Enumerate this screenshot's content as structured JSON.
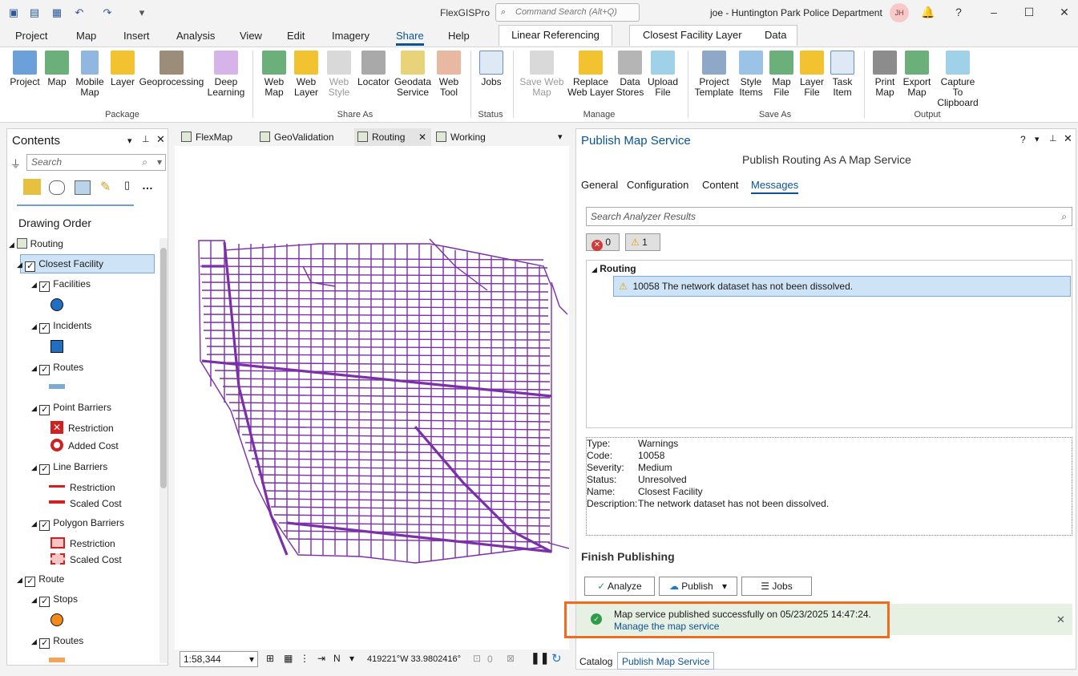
{
  "app": {
    "name": "FlexGISPro",
    "user": "joe - Huntington Park Police Department",
    "avatar_initials": "JH",
    "command_search_placeholder": "Command Search (Alt+Q)"
  },
  "menu": [
    "Project",
    "Map",
    "Insert",
    "Analysis",
    "View",
    "Edit",
    "Imagery",
    "Share",
    "Help"
  ],
  "context_tabs": [
    "Linear Referencing",
    "Closest Facility Layer",
    "Data"
  ],
  "ribbon": {
    "package": {
      "label": "Package",
      "items": [
        "Project",
        "Map",
        "Mobile Map",
        "Layer",
        "Geoprocessing",
        "Deep Learning"
      ]
    },
    "share_as": {
      "label": "Share As",
      "items": [
        "Web Map",
        "Web Layer",
        "Web Style",
        "Locator",
        "Geodata Service",
        "Web Tool"
      ]
    },
    "status": {
      "label": "Status",
      "items": [
        "Jobs"
      ]
    },
    "manage": {
      "label": "Manage",
      "items": [
        "Save Web Map",
        "Replace Web Layer",
        "Data Stores",
        "Upload File"
      ]
    },
    "save_as": {
      "label": "Save As",
      "items": [
        "Project Template",
        "Style Items",
        "Map File",
        "Layer File",
        "Task Item"
      ]
    },
    "output": {
      "label": "Output",
      "items": [
        "Print Map",
        "Export Map",
        "Capture To Clipboard"
      ]
    }
  },
  "contents": {
    "title": "Contents",
    "search_placeholder": "Search",
    "drawing_order": "Drawing Order",
    "map_name": "Routing",
    "layers": [
      "Closest Facility",
      "Facilities",
      "Incidents",
      "Routes",
      "Point Barriers",
      "Restriction",
      "Added Cost",
      "Line Barriers",
      "Restriction",
      "Scaled Cost",
      "Polygon Barriers",
      "Restriction",
      "Scaled Cost",
      "Route",
      "Stops",
      "Routes"
    ]
  },
  "map_tabs": [
    "FlexMap",
    "GeoValidation",
    "Routing",
    "Working"
  ],
  "statusbar": {
    "scale": "1:58,344",
    "coords": "419221°W 33.9802416°",
    "selected": "0"
  },
  "publish": {
    "title": "Publish Map Service",
    "subtitle": "Publish Routing As A Map Service",
    "tabs": [
      "General",
      "Configuration",
      "Content",
      "Messages"
    ],
    "search_placeholder": "Search Analyzer Results",
    "error_count": "0",
    "warning_count": "1",
    "group": "Routing",
    "message": "10058 The network dataset has not been dissolved.",
    "details": {
      "labels": [
        "Type:",
        "Code:",
        "Severity:",
        "Status:",
        "Name:",
        "Description:"
      ],
      "values": [
        "Warnings",
        "10058",
        "Medium",
        "Unresolved",
        "Closest Facility",
        "The network dataset has not been dissolved."
      ]
    },
    "finish_title": "Finish Publishing",
    "buttons": [
      "Analyze",
      "Publish",
      "Jobs"
    ],
    "toast": "Map service published successfully on 05/23/2025 14:47:24.",
    "toast_link": "Manage the map service"
  },
  "bottom_tabs": [
    "Catalog",
    "Publish Map Service"
  ],
  "colors": {
    "accent": "#0b5394",
    "map_lines": "#7b2fa8",
    "callout": "#f26a1b",
    "success": "#2e9c4a"
  }
}
